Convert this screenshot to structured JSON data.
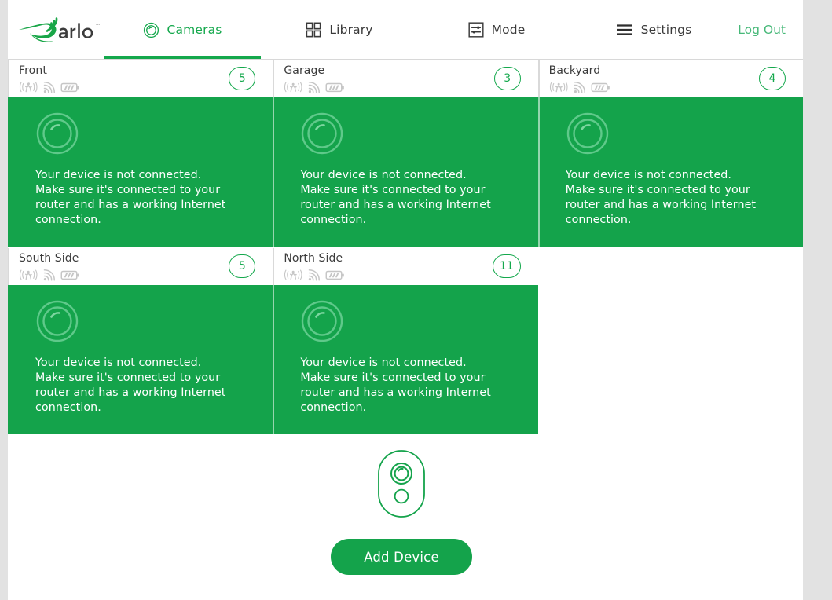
{
  "app": {
    "brand": "arlo",
    "brand_mark": "arlo-logo"
  },
  "colors": {
    "brand_green": "#14a34b",
    "accent_green": "#14a84c",
    "logout_green": "#46b878",
    "panel_green": "#14a34b",
    "page_gray": "#e2e2e2",
    "icon_gray": "#c6c6c6",
    "title_gray": "#3b3b3b"
  },
  "nav": {
    "items": [
      {
        "id": "cameras",
        "label": "Cameras",
        "icon": "camera-lens-icon",
        "active": true
      },
      {
        "id": "library",
        "label": "Library",
        "icon": "grid-squares-icon",
        "active": false
      },
      {
        "id": "mode",
        "label": "Mode",
        "icon": "sliders-icon",
        "active": false
      },
      {
        "id": "settings",
        "label": "Settings",
        "icon": "hamburger-menu-icon",
        "active": false
      }
    ],
    "logout_label": "Log Out"
  },
  "offline_message": "Your device is not connected. Make sure it's connected to your router and has a working Internet connection.",
  "status_icons": [
    {
      "name": "motion-detection-icon"
    },
    {
      "name": "signal-strength-icon"
    },
    {
      "name": "battery-icon"
    }
  ],
  "cameras": [
    {
      "id": "front",
      "name": "Front",
      "badge": "5",
      "status": "offline"
    },
    {
      "id": "garage",
      "name": "Garage",
      "badge": "3",
      "status": "offline"
    },
    {
      "id": "backyard",
      "name": "Backyard",
      "badge": "4",
      "status": "offline"
    },
    {
      "id": "south-side",
      "name": "South Side",
      "badge": "5",
      "status": "offline"
    },
    {
      "id": "north-side",
      "name": "North Side",
      "badge": "11",
      "status": "offline"
    }
  ],
  "add_device": {
    "button_label": "Add Device",
    "icon": "arlo-camera-device-icon"
  }
}
